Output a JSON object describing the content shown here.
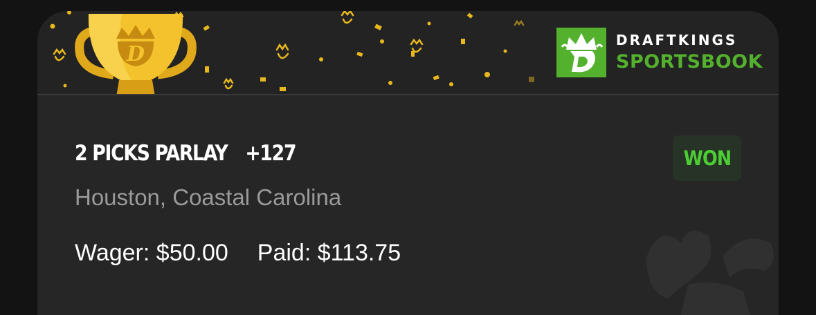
{
  "brand": {
    "line1": "DRAFTKINGS",
    "line2": "SPORTSBOOK",
    "logo_icon": "draftkings-crown-d-logo",
    "green": "#53B12E"
  },
  "banner": {
    "trophy_icon": "gold-trophy-icon",
    "trophy_color": "#F2C12E",
    "confetti_color": "#F2C12E"
  },
  "bet": {
    "title": "2 PICKS PARLAY",
    "odds": "+127",
    "status": "WON",
    "status_color": "#4CCD34",
    "selections": "Houston, Coastal Carolina",
    "wager_label": "Wager:",
    "wager_value": "$50.00",
    "paid_label": "Paid:",
    "paid_value": "$113.75"
  }
}
